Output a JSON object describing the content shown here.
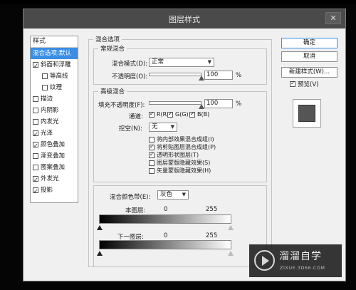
{
  "dialog": {
    "title": "图层样式",
    "close_label": "✕"
  },
  "styles_panel": {
    "header": "样式",
    "items": [
      {
        "label": "混合选项:默认",
        "checkbox": false,
        "checked": false,
        "selected": true,
        "sub": false
      },
      {
        "label": "斜面和浮雕",
        "checkbox": true,
        "checked": true,
        "selected": false,
        "sub": false
      },
      {
        "label": "等高线",
        "checkbox": true,
        "checked": false,
        "selected": false,
        "sub": true
      },
      {
        "label": "纹理",
        "checkbox": true,
        "checked": false,
        "selected": false,
        "sub": true
      },
      {
        "label": "描边",
        "checkbox": true,
        "checked": false,
        "selected": false,
        "sub": false
      },
      {
        "label": "内阴影",
        "checkbox": true,
        "checked": false,
        "selected": false,
        "sub": false
      },
      {
        "label": "内发光",
        "checkbox": true,
        "checked": false,
        "selected": false,
        "sub": false
      },
      {
        "label": "光泽",
        "checkbox": true,
        "checked": true,
        "selected": false,
        "sub": false
      },
      {
        "label": "颜色叠加",
        "checkbox": true,
        "checked": true,
        "selected": false,
        "sub": false
      },
      {
        "label": "渐变叠加",
        "checkbox": true,
        "checked": false,
        "selected": false,
        "sub": false
      },
      {
        "label": "图案叠加",
        "checkbox": true,
        "checked": false,
        "selected": false,
        "sub": false
      },
      {
        "label": "外发光",
        "checkbox": true,
        "checked": true,
        "selected": false,
        "sub": false
      },
      {
        "label": "投影",
        "checkbox": true,
        "checked": true,
        "selected": false,
        "sub": false
      }
    ]
  },
  "blend_options": {
    "title": "混合选项",
    "general": {
      "title": "常规混合",
      "mode_label": "混合模式(D):",
      "mode_value": "正常",
      "opacity_label": "不透明度(O):",
      "opacity_value": "100",
      "opacity_unit": "%",
      "opacity_level": 1.0
    },
    "advanced": {
      "title": "高级混合",
      "fill_label": "填充不透明度(F):",
      "fill_value": "100",
      "fill_unit": "%",
      "fill_level": 1.0,
      "channels_label": "通道:",
      "channels": [
        {
          "label": "R(R)",
          "checked": true
        },
        {
          "label": "G(G)",
          "checked": true
        },
        {
          "label": "B(B)",
          "checked": true
        }
      ],
      "knockout_label": "挖空(N):",
      "knockout_value": "无",
      "options": [
        {
          "label": "将内部效果混合成组(I)",
          "checked": false
        },
        {
          "label": "将剪贴图层混合成组(P)",
          "checked": true
        },
        {
          "label": "透明形状图层(T)",
          "checked": true
        },
        {
          "label": "图层蒙版隐藏效果(S)",
          "checked": false
        },
        {
          "label": "矢量蒙版隐藏效果(H)",
          "checked": false
        }
      ]
    },
    "blend_if": {
      "label": "混合颜色带(E):",
      "value": "灰色",
      "this_layer_label": "本图层:",
      "this_layer_min": "0",
      "this_layer_max": "255",
      "underlying_label": "下一图层:",
      "underlying_min": "0",
      "underlying_max": "255"
    }
  },
  "buttons": {
    "ok": "确定",
    "cancel": "取消",
    "new_style": "新建样式(W)...",
    "preview_label": "预览(V)",
    "preview_checked": true
  },
  "watermark": {
    "title": "溜溜自学",
    "url": "ZIXUE.3D66.COM"
  }
}
